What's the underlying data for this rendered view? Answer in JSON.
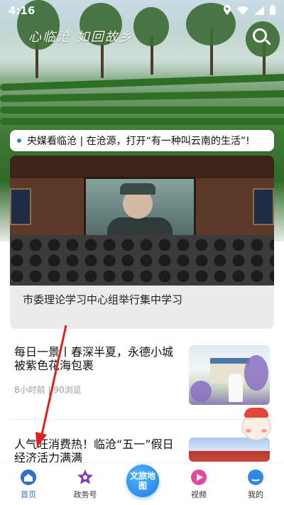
{
  "status_bar": {
    "time": "4:16"
  },
  "hero": {
    "calligraphy": "心临沧 如回故乡"
  },
  "ticker": {
    "text": "央媒看临沧 | 在沧源，打开“有一种叫云南的生活”!"
  },
  "featured": {
    "title": "市委理论学习中心组举行集中学习"
  },
  "news": [
    {
      "title": "每日一景丨春深半夏，永德小城被紫色花海包裹",
      "meta": "8小时前  | 90浏览"
    },
    {
      "title": "人气旺消费热！临沧“五一”假日经济活力满满",
      "meta": ""
    }
  ],
  "nav": {
    "items": [
      {
        "label": "首页",
        "icon": "home-icon"
      },
      {
        "label": "政务号",
        "icon": "star-icon"
      },
      {
        "label": "视频",
        "icon": "play-icon"
      },
      {
        "label": "我的",
        "icon": "profile-icon"
      }
    ],
    "center_label": "文旅地图"
  },
  "colors": {
    "accent": "#2a6fd1",
    "annotation_arrow": "#e02020"
  }
}
